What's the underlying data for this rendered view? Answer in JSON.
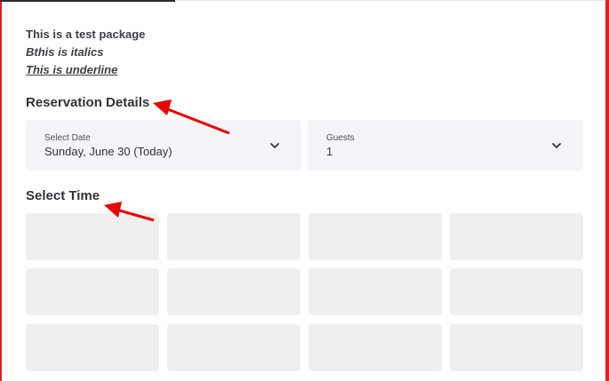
{
  "package": {
    "line1": "This is a test package",
    "line2": "Bthis is italics",
    "line3": "This is underline"
  },
  "reservation": {
    "title": "Reservation Details",
    "date": {
      "label": "Select Date",
      "value": "Sunday, June 30 (Today)"
    },
    "guests": {
      "label": "Guests",
      "value": "1"
    }
  },
  "time": {
    "title": "Select Time",
    "slots_count": 12
  },
  "colors": {
    "annotation_red": "#e02020",
    "select_bg": "#f4f5f8",
    "slot_bg": "#efefef"
  }
}
